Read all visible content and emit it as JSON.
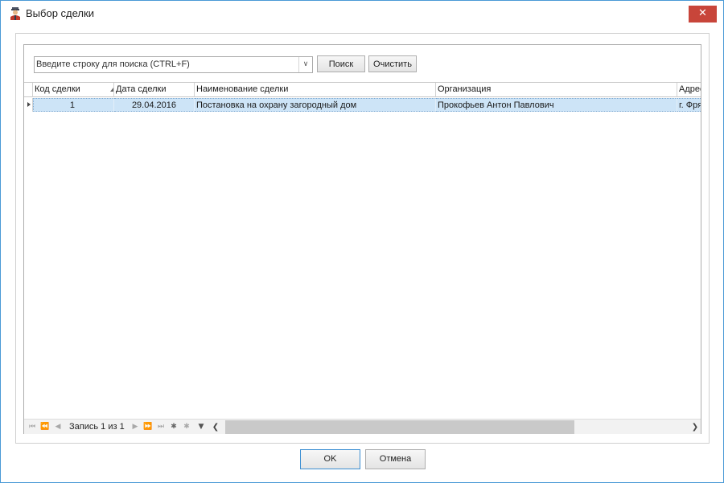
{
  "window": {
    "title": "Выбор сделки",
    "close_glyph": "✕"
  },
  "search": {
    "placeholder": "Введите строку для поиска (CTRL+F)",
    "search_button": "Поиск",
    "clear_button": "Очистить"
  },
  "grid": {
    "columns": [
      "Код сделки",
      "Дата сделки",
      "Наименование сделки",
      "Организация",
      "Адрес"
    ],
    "sort_column": "Код сделки",
    "rows": [
      [
        "1",
        "29.04.2016",
        "Постановка на охрану загородный дом",
        "Прокофьев Антон Павлович",
        "г. Фрязино"
      ]
    ]
  },
  "navigator": {
    "record_text": "Запись 1 из 1"
  },
  "footer": {
    "ok_button": "OK",
    "cancel_button": "Отмена"
  },
  "colors": {
    "selected_row": "#cde4f7",
    "window_border": "#4a9ad6",
    "close_button": "#c8453a"
  },
  "icons": {
    "window_icon": "user-icon",
    "dropdown": "chevron-down-icon",
    "sort": "sort-ascending-icon",
    "row_indicator": "row-pointer-icon"
  }
}
